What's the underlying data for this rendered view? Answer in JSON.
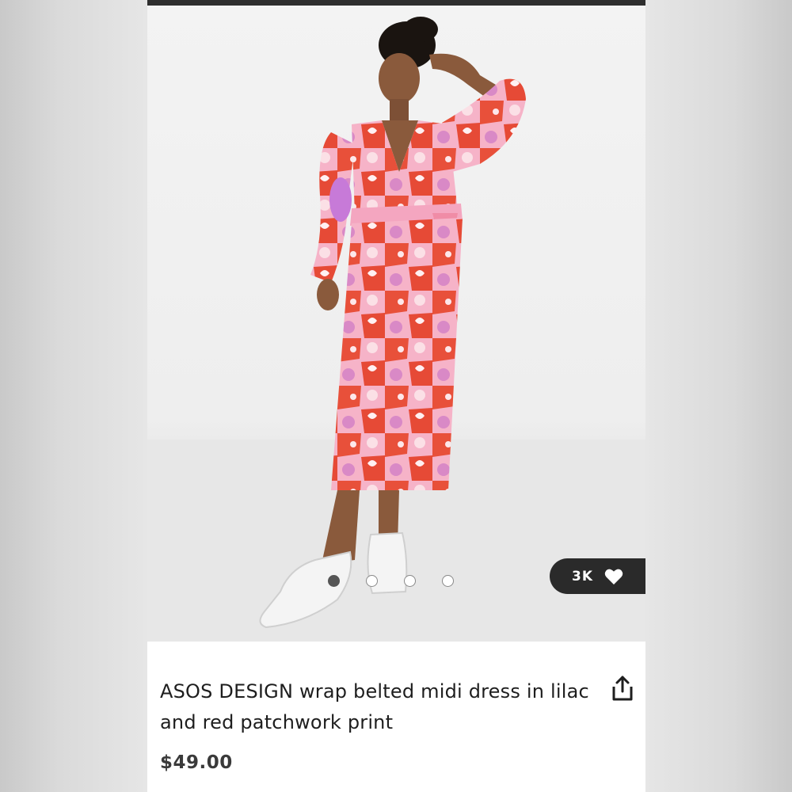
{
  "product": {
    "title": "ASOS DESIGN wrap belted midi dress in lilac and red patchwork print",
    "price": "$49.00",
    "likes": "3K",
    "image_count": 4,
    "active_image_index": 0
  },
  "icons": {
    "like": "heart-icon",
    "share": "share-icon"
  },
  "colors": {
    "like_pill": "#2a2a2a",
    "dress_red": "#e8503a",
    "dress_pink": "#f4a6c0"
  }
}
